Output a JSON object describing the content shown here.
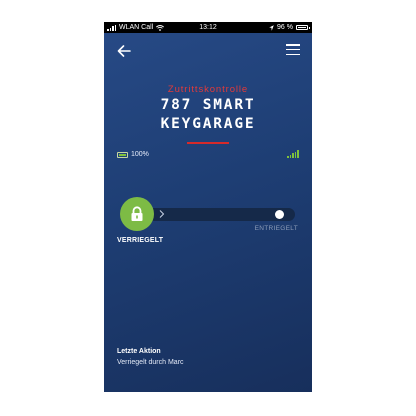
{
  "statusbar": {
    "carrier": "WLAN Call",
    "time": "13:12",
    "battery": "96 %"
  },
  "header": {
    "back_icon": "arrow-left-icon",
    "menu_icon": "hamburger-menu-icon"
  },
  "device": {
    "subtitle": "Zutrittskontrolle",
    "title_line1": "787 SMART",
    "title_line2": "KEYGARAGE",
    "battery_level": "100%",
    "battery_fraction": 1.0,
    "signal_bars": 5
  },
  "lock": {
    "state_label": "VERRIEGELT",
    "target_label": "ENTRIEGELT",
    "icon": "padlock-icon",
    "slider_icon": "chevron-right-icon"
  },
  "last_action": {
    "title": "Letzte Aktion",
    "text": "Verriegelt durch Marc"
  },
  "colors": {
    "accent_red": "#e23a3a",
    "lock_green": "#7dbb45",
    "background": "#1f3f76"
  }
}
